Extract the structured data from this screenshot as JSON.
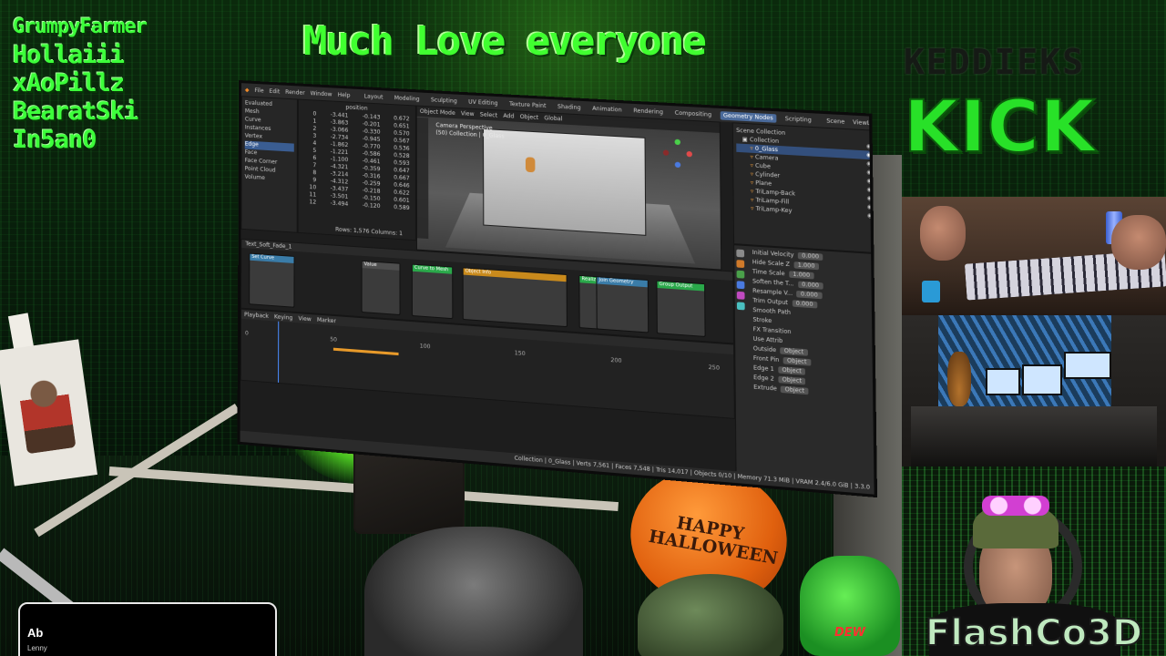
{
  "overlay": {
    "donors": [
      "GrumpyFarmer",
      "Hollaiii",
      "xAoPillz",
      "BearatSki",
      "In5an0"
    ],
    "banner": "Much Love everyone",
    "kick_small": "KEDDIEKS",
    "kick_big": "KICK",
    "brand": "FlashCo3D",
    "balloon_text": "HAPPY HALLOWEEN",
    "bottle_text": "DEW",
    "alert": {
      "title": "Ab",
      "subtitle": "Lenny"
    }
  },
  "blender": {
    "menu": [
      "File",
      "Edit",
      "Render",
      "Window",
      "Help"
    ],
    "workspaces": [
      "Layout",
      "Modeling",
      "Sculpting",
      "UV Editing",
      "Texture Paint",
      "Shading",
      "Animation",
      "Rendering",
      "Compositing",
      "Geometry Nodes",
      "Scripting"
    ],
    "active_workspace": "Geometry Nodes",
    "scene": "Scene",
    "view_layer": "ViewLayer",
    "left_outliner": [
      "Evaluated",
      "Mesh",
      "Curve",
      "Instances",
      "Vertex",
      "Edge",
      "Face",
      "Face Corner",
      "Point Cloud",
      "Volume"
    ],
    "spreadsheet_header": "position",
    "spreadsheet_rows": [
      [
        "0",
        "-3.441",
        "-0.143",
        "0.672"
      ],
      [
        "1",
        "-3.863",
        "-0.201",
        "0.651"
      ],
      [
        "2",
        "-3.066",
        "-0.330",
        "0.570"
      ],
      [
        "3",
        "-2.734",
        "-0.945",
        "0.567"
      ],
      [
        "4",
        "-1.862",
        "-0.770",
        "0.536"
      ],
      [
        "5",
        "-1.221",
        "-0.586",
        "0.528"
      ],
      [
        "6",
        "-1.100",
        "-0.461",
        "0.593"
      ],
      [
        "7",
        "-4.321",
        "-0.359",
        "0.647"
      ],
      [
        "8",
        "-3.214",
        "-0.316",
        "0.667"
      ],
      [
        "9",
        "-4.312",
        "-0.259",
        "0.646"
      ],
      [
        "10",
        "-3.437",
        "-0.218",
        "0.622"
      ],
      [
        "11",
        "-3.501",
        "-0.150",
        "0.601"
      ],
      [
        "12",
        "-3.494",
        "-0.120",
        "0.589"
      ]
    ],
    "spreadsheet_footer": "Rows: 1,576  Columns: 1",
    "viewport_menu": [
      "Object Mode",
      "View",
      "Select",
      "Add",
      "Object",
      "Global"
    ],
    "viewport_info": [
      "Camera Perspective",
      "(50) Collection | 0_Glass"
    ],
    "outliner_title": "Scene Collection",
    "outliner_items": [
      "Collection",
      "0_Glass",
      "Camera",
      "Cube",
      "Cylinder",
      "Plane",
      "TriLamp-Back",
      "TriLamp-Fill",
      "TriLamp-Key"
    ],
    "props": [
      {
        "label": "Initial Velocity",
        "value": "0.000"
      },
      {
        "label": "Hide Scale Z",
        "value": "1.000"
      },
      {
        "label": "Time Scale",
        "value": "1.000"
      },
      {
        "label": "Soften the T...",
        "value": "0.000"
      },
      {
        "label": "Resample V...",
        "value": "0.000"
      },
      {
        "label": "Trim Output",
        "value": "0.000"
      },
      {
        "label": "Smooth Path",
        "value": ""
      },
      {
        "label": "Stroke",
        "value": ""
      },
      {
        "label": "FX Transition",
        "value": ""
      },
      {
        "label": "Use Attrib",
        "value": ""
      },
      {
        "label": "Outside",
        "value": "Object"
      },
      {
        "label": "Front Pin",
        "value": "Object"
      },
      {
        "label": "Edge 1",
        "value": "Object"
      },
      {
        "label": "Edge 2",
        "value": "Object"
      },
      {
        "label": "Extrude",
        "value": "Object"
      }
    ],
    "node_editor_label": "Text_Soft_Fade_1",
    "nodes": [
      {
        "title": "Set Curve",
        "color": "#3a7ca8"
      },
      {
        "title": "Value",
        "color": "#4e4e4e"
      },
      {
        "title": "Curve to Mesh",
        "color": "#2aa84a"
      },
      {
        "title": "Object Info",
        "color": "#c98a1c"
      },
      {
        "title": "Realize",
        "color": "#2aa84a"
      },
      {
        "title": "Join Geometry",
        "color": "#3a7ca8"
      },
      {
        "title": "Group Output",
        "color": "#2aa84a"
      }
    ],
    "timeline_menu": [
      "Playback",
      "Keying",
      "View",
      "Marker"
    ],
    "timeline_ticks": [
      "0",
      "50",
      "100",
      "150",
      "200",
      "250"
    ],
    "statusbar": "Collection | 0_Glass | Verts 7,561 | Faces 7,548 | Tris 14,017 | Objects 0/10 | Memory 71.3 MiB | VRAM 2.4/6.0 GiB | 3.3.0"
  },
  "colors": {
    "neon_green": "#3cff3a",
    "kick_green": "#28e128",
    "blender_bg": "#1d1d1d",
    "blender_accent": "#4a6a9a",
    "balloon_orange": "#e0600e"
  }
}
